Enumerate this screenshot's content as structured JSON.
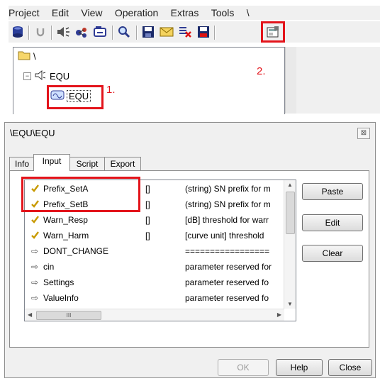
{
  "menu": {
    "items": [
      "Project",
      "Edit",
      "View",
      "Operation",
      "Extras",
      "Tools",
      "\\"
    ]
  },
  "tree": {
    "root_label": "\\",
    "parent_label": "EQU",
    "child_label": "EQU"
  },
  "annotations": {
    "step1": "1.",
    "step2": "2."
  },
  "dialog": {
    "title": "\\EQU\\EQU",
    "close_glyph": "⊠",
    "tabs": [
      "Info",
      "Input",
      "Script",
      "Export"
    ],
    "active_tab": "Input",
    "rows": [
      {
        "icon": "check-icon",
        "name": "Prefix_SetA",
        "unit": "[]",
        "desc": "(string) SN prefix for m"
      },
      {
        "icon": "check-icon",
        "name": "Prefix_SetB",
        "unit": "[]",
        "desc": "(string) SN prefix for m"
      },
      {
        "icon": "check-icon",
        "name": "Warn_Resp",
        "unit": "[]",
        "desc": "[dB] threshold for warr"
      },
      {
        "icon": "check-icon",
        "name": "Warn_Harm",
        "unit": "[]",
        "desc": "[curve unit] threshold"
      },
      {
        "icon": "arrow-icon",
        "name": "DONT_CHANGE",
        "unit": "",
        "desc": "================="
      },
      {
        "icon": "arrow-icon",
        "name": "cin",
        "unit": "",
        "desc": "parameter reserved for"
      },
      {
        "icon": "arrow-icon",
        "name": "Settings",
        "unit": "",
        "desc": "parameter reserved fo"
      },
      {
        "icon": "arrow-icon",
        "name": "ValueInfo",
        "unit": "",
        "desc": "parameter reserved fo"
      }
    ],
    "buttons": {
      "paste": "Paste",
      "edit": "Edit",
      "clear": "Clear",
      "ok": "OK",
      "help": "Help",
      "close": "Close"
    },
    "hscroll_thumb_grip": "III"
  },
  "colors": {
    "highlight": "#e3141b",
    "check": "#c89a00",
    "arrow": "#555555"
  }
}
